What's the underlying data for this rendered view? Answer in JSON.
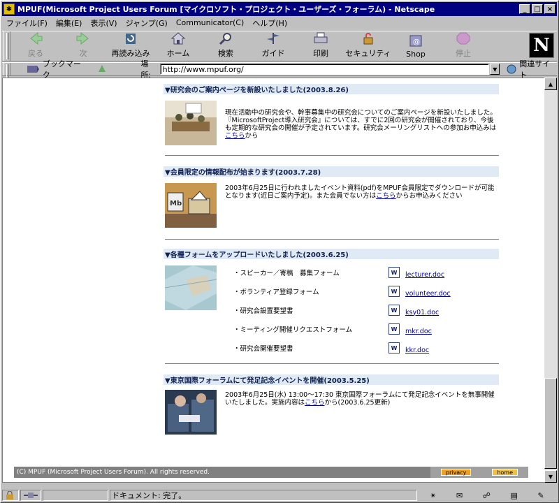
{
  "window": {
    "title": "MPUF(Microsoft Project Users Forum [マイクロソフト・プロジェクト・ユーザーズ・フォーラム) - Netscape",
    "app_icon": "netscape-icon",
    "controls": {
      "minimize": "_",
      "maximize": "□",
      "close": "×"
    }
  },
  "menu": [
    "ファイル(F)",
    "編集(E)",
    "表示(V)",
    "ジャンプ(G)",
    "Communicator(C)",
    "ヘルプ(H)"
  ],
  "toolbar": {
    "items": [
      {
        "label": "戻る",
        "icon": "back-icon",
        "disabled": true
      },
      {
        "label": "次",
        "icon": "forward-icon",
        "disabled": true
      },
      {
        "label": "再読み込み",
        "icon": "reload-icon",
        "disabled": false
      },
      {
        "label": "ホーム",
        "icon": "home-icon",
        "disabled": false
      },
      {
        "label": "検索",
        "icon": "search-icon",
        "disabled": false
      },
      {
        "label": "ガイド",
        "icon": "guide-icon",
        "disabled": false
      },
      {
        "label": "印刷",
        "icon": "print-icon",
        "disabled": false
      },
      {
        "label": "セキュリティ",
        "icon": "security-icon",
        "disabled": false
      },
      {
        "label": "Shop",
        "icon": "shop-icon",
        "disabled": false
      },
      {
        "label": "停止",
        "icon": "stop-icon",
        "disabled": true
      }
    ],
    "logo": "N"
  },
  "location": {
    "bookmarks_label": "ブックマーク",
    "location_label": "場所:",
    "url": "http://www.mpuf.org/",
    "related_label": "関連サイト"
  },
  "sections": [
    {
      "heading": "▼研究会のご案内ページを新設いたしました(2003.8.26)",
      "text_before": "現在活動中の研究会や、幹事募集中の研究会についてのご案内ページを新設いたしました。『MicrosoftProject導入研究会』については、すでに2回の研究会が開催されており、今後も定期的な研究会の開催が予定されています。研究会メーリングリストへの参加お申込みは",
      "link": "こちら",
      "text_after": "から"
    },
    {
      "heading": "▼会員限定の情報配布が始まります(2003.7.28)",
      "text_before": "2003年6月25日に行われましたイベント資料(pdf)をMPUF会員限定でダウンロードが可能となります(近日ご案内予定)。また会員でない方は",
      "link": "こちら",
      "text_after": "からお申込みください"
    },
    {
      "heading": "▼各種フォームをアップロードいたしました(2003.6.25)",
      "forms": [
        {
          "label": "・スピーカー／寄稿　募集フォーム",
          "file": "lecturer.doc"
        },
        {
          "label": "・ボランティア登録フォーム",
          "file": "volunteer.doc"
        },
        {
          "label": "・研究会設置要望書",
          "file": "ksy01.doc"
        },
        {
          "label": "・ミーティング開催リクエストフォーム",
          "file": "mkr.doc"
        },
        {
          "label": "・研究会開催要望書",
          "file": "kkr.doc"
        }
      ]
    },
    {
      "heading": "▼東京国際フォーラムにて発足記念イベントを開催(2003.5.25)",
      "text_before": "2003年6月25日(水) 13:00～17:30 東京国際フォーラムにて発足記念イベントを無事開催いたしました。実施内容は",
      "link": "こちら",
      "text_after": "から(2003.6.25更新)"
    }
  ],
  "footer": {
    "copyright": "(C) MPUF (Microsoft Project Users Forum). All rights reserved.",
    "privacy": "privacy",
    "home": "home"
  },
  "status": {
    "text": "ドキュメント: 完了。"
  },
  "colors": {
    "titlebar": "#000080",
    "section_head_bg": "#e0eaf5",
    "link": "#0000a0",
    "footer_btn": "#f0a020"
  }
}
